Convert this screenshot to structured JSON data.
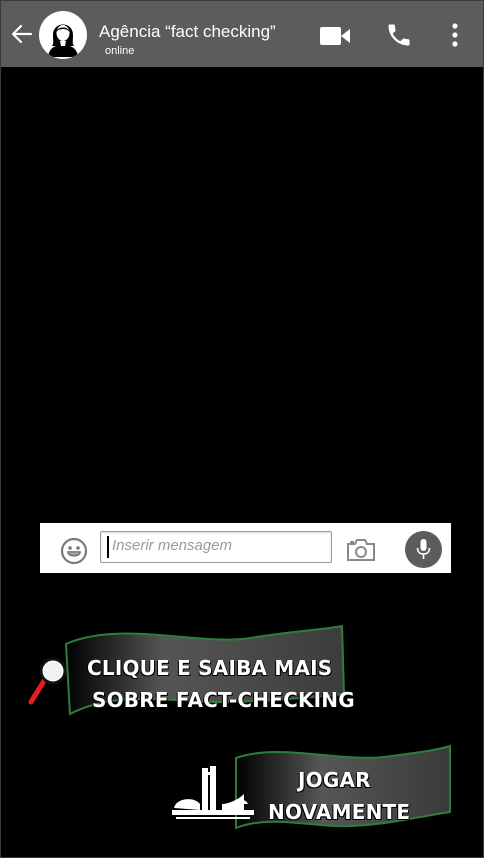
{
  "header": {
    "title": "Agência “fact checking”",
    "status": "online",
    "icons": [
      "back-arrow-icon",
      "avatar-woman-icon",
      "video-call-icon",
      "phone-icon",
      "more-vert-icon"
    ],
    "background_color": "#5b5c5c"
  },
  "composer": {
    "placeholder": "Inserir mensagem",
    "value": "",
    "icons": [
      "emoji-icon",
      "camera-icon",
      "microphone-icon"
    ]
  },
  "actions": {
    "learn_more": {
      "line1": "CLIQUE E SAIBA MAIS",
      "line2": "SOBRE FACT-CHECKING",
      "icon": "magnifier-icon"
    },
    "play_again": {
      "line1": "JOGAR",
      "line2": "NOVAMENTE",
      "icon": "congress-building-icon"
    }
  },
  "colors": {
    "banner_border": "#2f7d3a",
    "banner_fill": "#4a4a4a",
    "mic_button": "#5b5c5c",
    "magnifier_handle": "#e02020"
  }
}
